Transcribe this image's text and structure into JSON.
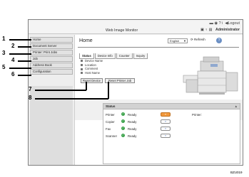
{
  "window": {
    "title": "Web Image Monitor",
    "toolbar_glyphs": "▬ ◉ ? i",
    "logout_label": "Logout",
    "user_label": "Administrator"
  },
  "nav": {
    "items": [
      {
        "label": "Home"
      },
      {
        "label": "Document Server"
      },
      {
        "label": "Printer: Print Jobs"
      },
      {
        "label": "Job"
      },
      {
        "label": "Address Book"
      },
      {
        "label": "Configuration"
      }
    ]
  },
  "main": {
    "title": "Home",
    "language": "English",
    "refresh_label": "Refresh",
    "help_label": "?",
    "tabs": [
      "Status",
      "Device Info",
      "Counter",
      "Inquiry"
    ],
    "checks": [
      "Device Name",
      "Location",
      "Comment",
      "Host Name"
    ],
    "reset_device_label": "Reset Device",
    "reset_printer_job_label": "Reset Printer Job"
  },
  "status": {
    "heading": "Status",
    "rows": [
      {
        "label": "Printer",
        "value": "Ready"
      },
      {
        "label": "Copier",
        "value": "Ready"
      },
      {
        "label": "Fax",
        "value": "Ready"
      },
      {
        "label": "Scanner",
        "value": "Ready"
      }
    ],
    "printer_label": "Printer:"
  },
  "callouts": [
    "1",
    "2",
    "3",
    "4",
    "5",
    "6",
    "7",
    "8"
  ],
  "figure_code": "BZU019",
  "colors": {
    "accent": "#6b8fc4",
    "ready": "#3aa24a",
    "go_active": "#f29a3d"
  }
}
